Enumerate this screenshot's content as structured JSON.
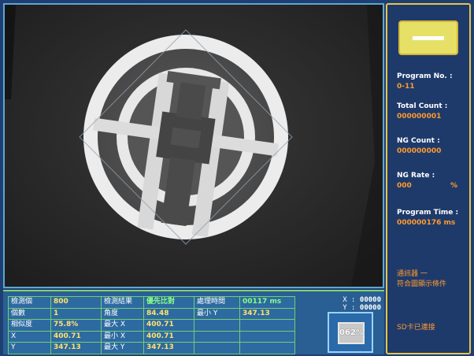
{
  "stats": {
    "rows": [
      [
        "檢測個",
        "800",
        "檢測結果",
        "優先比對",
        "處理時間",
        "00117 ms"
      ],
      [
        "個數",
        "1",
        "角度",
        "84.48",
        "最小 Y",
        "347.13"
      ],
      [
        "相似度",
        "75.8%",
        "最大 X",
        "400.71",
        "",
        ""
      ],
      [
        "X",
        "400.71",
        "最小 X",
        "400.71",
        "",
        ""
      ],
      [
        "Y",
        "347.13",
        "最大 Y",
        "347.13",
        "",
        ""
      ]
    ]
  },
  "coords": {
    "x_label": "X :",
    "x_value": "00000",
    "y_label": "Y :",
    "y_value": "00000"
  },
  "zoom": {
    "label": "062%"
  },
  "side": {
    "program_no_label": "Program No. :",
    "program_no_value": "0-11",
    "total_count_label": "Total Count :",
    "total_count_value": "000000001",
    "ng_count_label": "NG Count :",
    "ng_count_value": "000000000",
    "ng_rate_label": "NG Rate :",
    "ng_rate_value": "000",
    "ng_rate_unit": "%",
    "program_time_label": "Program Time :",
    "program_time_value": "000000176 ms",
    "message_line1": "通訊器 一",
    "message_line2": "符合圖顯示條件",
    "sd_status": "SD卡已連接"
  },
  "colors": {
    "frame_bg": "#1f3f73",
    "table_border": "#6fd06f",
    "value_yellow": "#ffe36b",
    "value_orange": "#ff9a2e",
    "indicator_yellow": "#e6e066"
  }
}
